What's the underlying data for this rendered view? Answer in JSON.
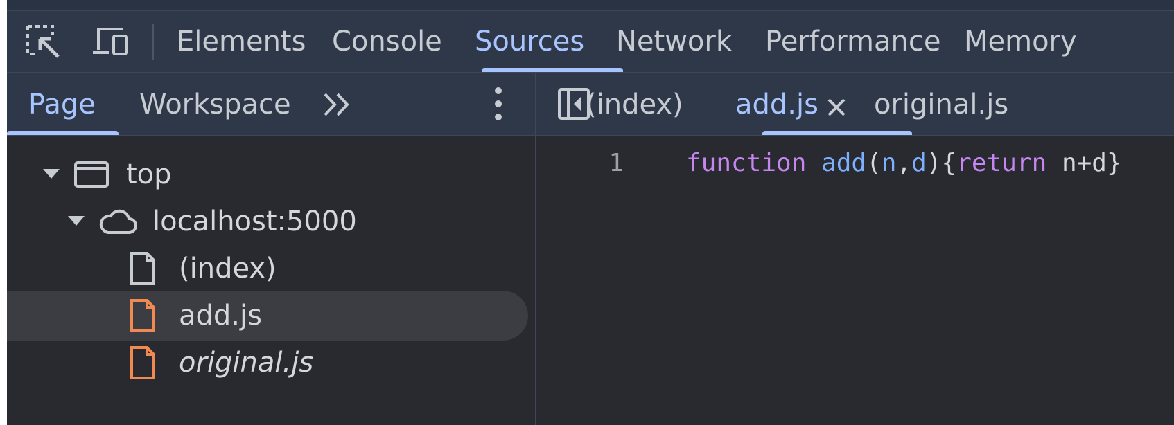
{
  "colors": {
    "background": "#282a2f",
    "toolbar": "#2f3848",
    "accent": "#a8c4ff",
    "text": "#c7cbd2",
    "js_file_icon": "#f08a52",
    "keyword": "#c586f0",
    "function_name": "#7fb0ff"
  },
  "toolbar": {
    "icons": [
      "inspect-element-icon",
      "device-toolbar-icon"
    ],
    "tabs": [
      {
        "label": "Elements",
        "active": false
      },
      {
        "label": "Console",
        "active": false
      },
      {
        "label": "Sources",
        "active": true
      },
      {
        "label": "Network",
        "active": false
      },
      {
        "label": "Performance",
        "active": false
      },
      {
        "label": "Memory",
        "active": false
      }
    ]
  },
  "navigator": {
    "tabs": [
      {
        "label": "Page",
        "active": true
      },
      {
        "label": "Workspace",
        "active": false
      }
    ],
    "more_icon": "chevron-double-right-icon",
    "menu_icon": "more-vertical-icon",
    "tree": {
      "frame": {
        "label": "top",
        "icon": "frame-icon",
        "expanded": true
      },
      "origin": {
        "label": "localhost:5000",
        "icon": "cloud-icon",
        "expanded": true
      },
      "files": [
        {
          "label": "(index)",
          "icon": "document-icon",
          "selected": false,
          "italic": false
        },
        {
          "label": "add.js",
          "icon": "js-file-icon",
          "selected": true,
          "italic": false
        },
        {
          "label": "original.js",
          "icon": "js-file-icon",
          "selected": false,
          "italic": true
        }
      ]
    }
  },
  "editor": {
    "toggle_icon": "toggle-navigator-icon",
    "tabs": [
      {
        "label": "(index)",
        "active": false
      },
      {
        "label": "add.js",
        "active": true,
        "closable": true
      },
      {
        "label": "original.js",
        "active": false
      }
    ],
    "lines": [
      {
        "number": "1",
        "tokens": {
          "kw1": "function",
          "sp1": " ",
          "fn": "add",
          "p1": "(",
          "a1": "n",
          "c1": ",",
          "a2": "d",
          "p2": "){",
          "kw2": "return",
          "rest": " n+d}"
        }
      }
    ]
  }
}
